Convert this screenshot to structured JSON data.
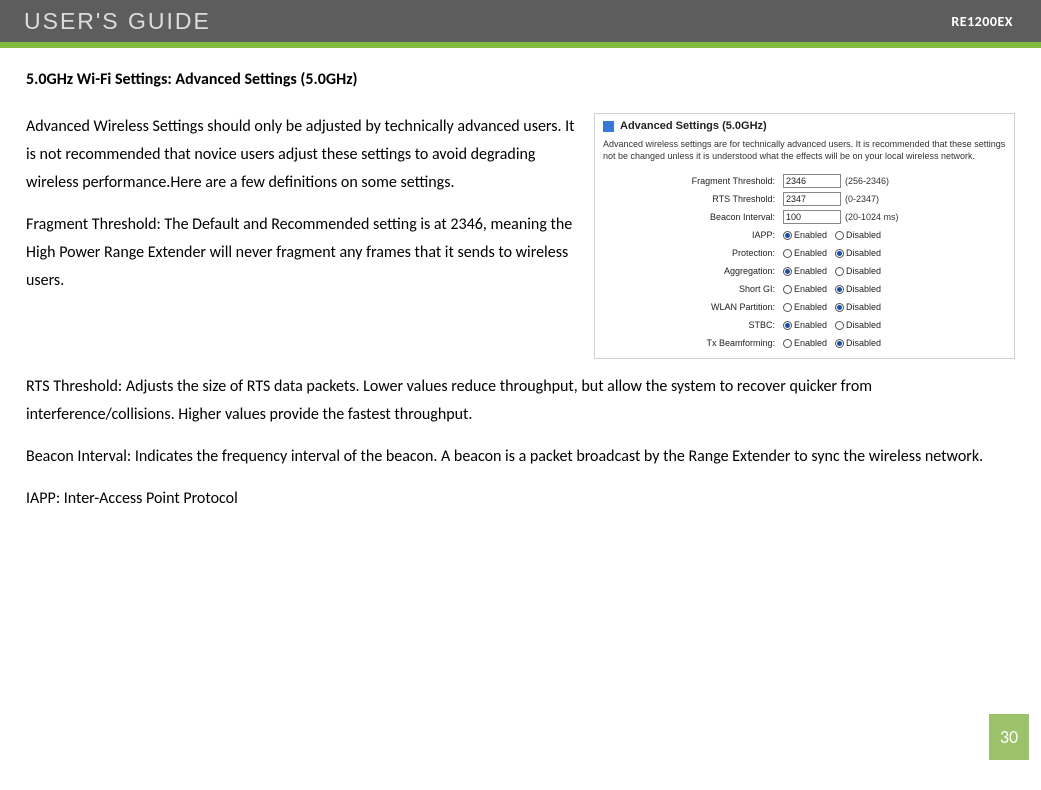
{
  "header": {
    "title": "USER'S GUIDE",
    "model": "RE1200EX"
  },
  "section": {
    "heading": "5.0GHz Wi-Fi Settings: Advanced Settings (5.0GHz)"
  },
  "body": {
    "p1": "Advanced Wireless Settings should only be adjusted by technically advanced users. It is not recommended that novice users adjust these settings to avoid degrading wireless performance.Here are a few definitions on some settings.",
    "p2": "Fragment Threshold: The Default and Recommended setting is at 2346, meaning the High Power Range Extender will never fragment any frames that it sends to wireless users.",
    "p3": "RTS Threshold: Adjusts the size of RTS data packets. Lower values reduce throughput, but allow the system to recover quicker from interference/collisions. Higher values provide the fastest throughput.",
    "p4": "Beacon Interval: Indicates the frequency interval of the beacon. A beacon is a packet broadcast by the Range Extender to sync the wireless network.",
    "p5": "IAPP: Inter-Access Point Protocol"
  },
  "panel": {
    "title": "Advanced Settings (5.0GHz)",
    "desc": "Advanced wireless settings are for technically advanced users. It is recommended that these settings not be changed unless it is understood what the effects will be on your local wireless network.",
    "radio_enabled": "Enabled",
    "radio_disabled": "Disabled",
    "rows": {
      "fragment": {
        "label": "Fragment Threshold:",
        "value": "2346",
        "range": "(256-2346)"
      },
      "rts": {
        "label": "RTS Threshold:",
        "value": "2347",
        "range": "(0-2347)"
      },
      "beacon": {
        "label": "Beacon Interval:",
        "value": "100",
        "range": "(20-1024 ms)"
      },
      "iapp": {
        "label": "IAPP:",
        "selected": "enabled"
      },
      "protection": {
        "label": "Protection:",
        "selected": "disabled"
      },
      "aggregation": {
        "label": "Aggregation:",
        "selected": "enabled"
      },
      "shortgi": {
        "label": "Short GI:",
        "selected": "disabled"
      },
      "wlan": {
        "label": "WLAN Partition:",
        "selected": "disabled"
      },
      "stbc": {
        "label": "STBC:",
        "selected": "enabled"
      },
      "txbf": {
        "label": "Tx Beamforming:",
        "selected": "disabled"
      }
    }
  },
  "page_number": "30"
}
